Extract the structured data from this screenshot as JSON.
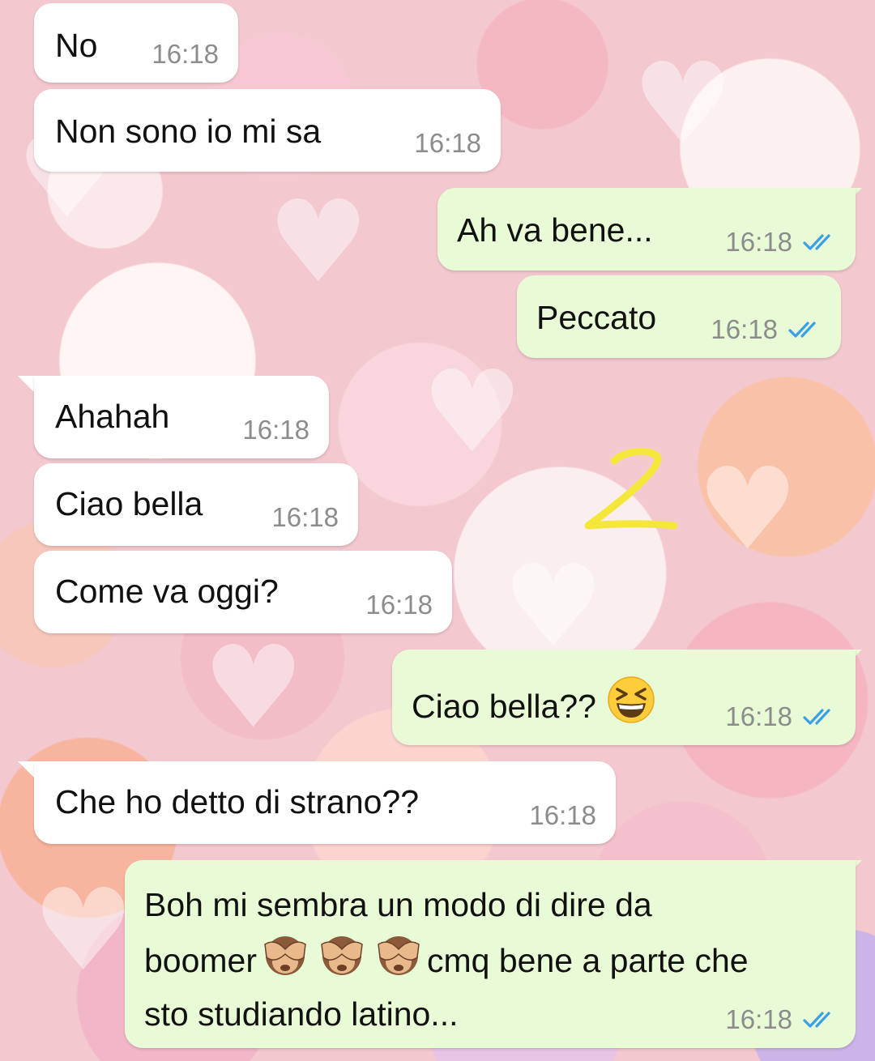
{
  "chat": {
    "messages": [
      {
        "text": "No",
        "time": "16:18",
        "direction": "incoming"
      },
      {
        "text": "Non sono io mi sa",
        "time": "16:18",
        "direction": "incoming"
      },
      {
        "text": "Ah va bene...",
        "time": "16:18",
        "direction": "outgoing",
        "status": "read"
      },
      {
        "text": "Peccato",
        "time": "16:18",
        "direction": "outgoing",
        "status": "read"
      },
      {
        "text": "Ahahah",
        "time": "16:18",
        "direction": "incoming"
      },
      {
        "text": "Ciao bella",
        "time": "16:18",
        "direction": "incoming"
      },
      {
        "text": "Come va oggi?",
        "time": "16:18",
        "direction": "incoming"
      },
      {
        "text": "Ciao bella??",
        "emoji": "grinning-squinting-face",
        "time": "16:18",
        "direction": "outgoing",
        "status": "read"
      },
      {
        "text": "Che ho detto di strano??",
        "time": "16:18",
        "direction": "incoming"
      },
      {
        "line1": "Boh mi sembra un modo di dire da",
        "line2_a": "boomer",
        "line2_emojis": [
          "see-no-evil-monkey",
          "see-no-evil-monkey",
          "see-no-evil-monkey"
        ],
        "line2_b": "cmq bene a parte che",
        "line3": "sto studiando latino...",
        "time": "16:18",
        "direction": "outgoing",
        "status": "read"
      }
    ]
  },
  "annotation": {
    "text": "2",
    "color": "#f5e63a"
  },
  "colors": {
    "incoming_bubble": "#ffffff",
    "outgoing_bubble": "#e8fbd6",
    "timestamp": "#8c8c8c",
    "read_ticks": "#3aa0e6"
  },
  "icons": {
    "read_receipt": "double-check-icon"
  }
}
